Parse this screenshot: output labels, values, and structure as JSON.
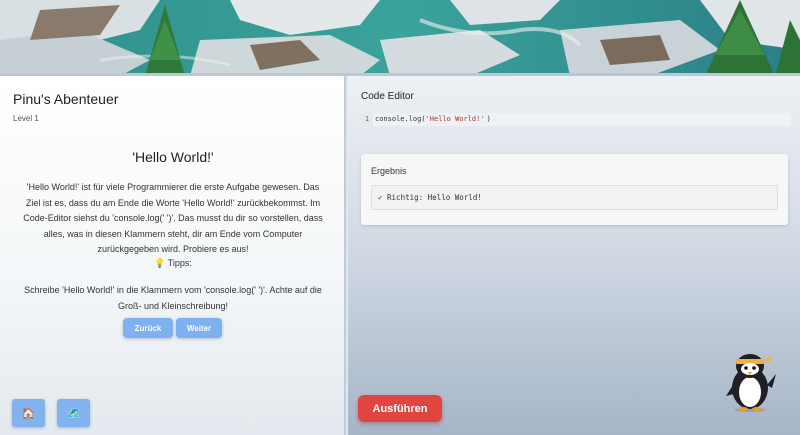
{
  "lesson": {
    "game_title": "Pinu's Abenteuer",
    "level": "Level 1",
    "title": "'Hello World!'",
    "description": "'Hello World!' ist für viele Programmierer die erste Aufgabe gewesen. Das Ziel ist es, dass du am Ende die Worte 'Hello World!' zurückbekommst. Im Code-Editor siehst du 'console.log(' ')'. Das musst du dir so vorstellen, dass alles, was in diesen Klammern steht, dir am Ende vom Computer zurückgegeben wird. Probiere es aus!",
    "tips_label": "💡 Tipps:",
    "tips_text": "Schreibe 'Hello World!' in die Klammern vom 'console.log(' ')'. Achte auf die Groß- und Kleinschreibung!",
    "back_label": "Zurück",
    "next_label": "Weiter",
    "home_icon": "🏠",
    "map_icon": "🗺️"
  },
  "editor": {
    "title": "Code Editor",
    "line_number": "1",
    "code_prefix": "console.log(",
    "code_string": "'Hello World!'",
    "code_suffix": ")"
  },
  "result": {
    "title": "Ergebnis",
    "output": "✓ Richtig: Hello World!"
  },
  "run_label": "Ausführen",
  "colors": {
    "accent_blue": "#7fb0f0",
    "run_red": "#e0463f"
  }
}
